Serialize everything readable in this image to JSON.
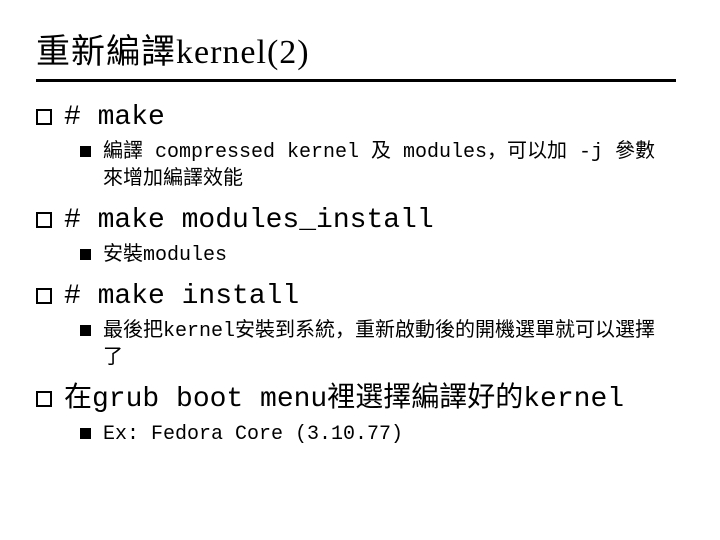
{
  "title": "重新編譯kernel(2)",
  "items": [
    {
      "text": "# make",
      "sub": "編譯 compressed kernel 及 modules，可以加 -j 參數來增加編譯效能"
    },
    {
      "text": "# make modules_install",
      "sub": "安裝modules"
    },
    {
      "text": "# make install",
      "sub": "最後把kernel安裝到系統，重新啟動後的開機選單就可以選擇了"
    },
    {
      "text": "在grub boot menu裡選擇編譯好的kernel",
      "sub": "Ex: Fedora Core (3.10.77)"
    }
  ]
}
